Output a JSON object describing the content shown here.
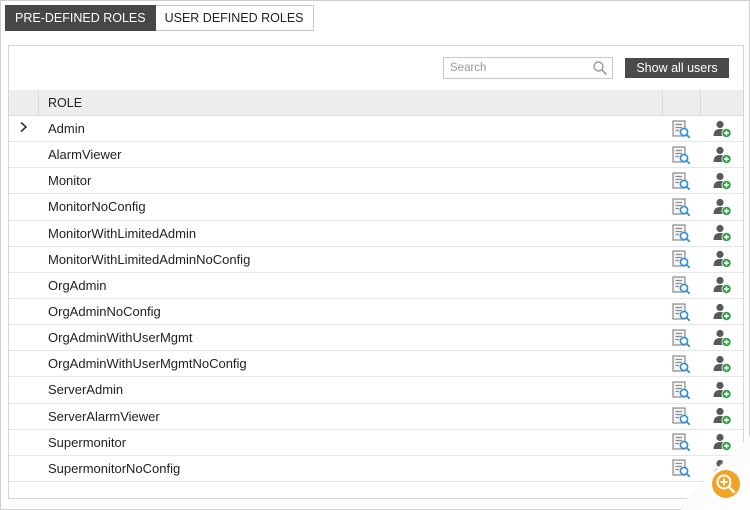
{
  "tabs": [
    {
      "label": "PRE-DEFINED ROLES",
      "active": true
    },
    {
      "label": "USER DEFINED ROLES",
      "active": false
    }
  ],
  "toolbar": {
    "search_placeholder": "Search",
    "search_value": "",
    "show_all_label": "Show all users"
  },
  "grid": {
    "header": {
      "role": "ROLE"
    },
    "rows": [
      {
        "role": "Admin",
        "expandable": true
      },
      {
        "role": "AlarmViewer"
      },
      {
        "role": "Monitor"
      },
      {
        "role": "MonitorNoConfig"
      },
      {
        "role": "MonitorWithLimitedAdmin"
      },
      {
        "role": "MonitorWithLimitedAdminNoConfig"
      },
      {
        "role": "OrgAdmin"
      },
      {
        "role": "OrgAdminNoConfig"
      },
      {
        "role": "OrgAdminWithUserMgmt"
      },
      {
        "role": "OrgAdminWithUserMgmtNoConfig"
      },
      {
        "role": "ServerAdmin"
      },
      {
        "role": "ServerAlarmViewer"
      },
      {
        "role": "Supermonitor"
      },
      {
        "role": "SupermonitorNoConfig"
      }
    ]
  },
  "icons": {
    "row_view": "view-role-icon",
    "row_add": "add-user-icon",
    "search": "search-icon",
    "expand": "chevron-right-icon",
    "zoom": "zoom-in-icon"
  },
  "colors": {
    "active_tab": "#474747",
    "button": "#4a4a4a",
    "add_user_green": "#2e9e45",
    "view_blue": "#2a8fd6",
    "zoom_orange": "#f0a325"
  }
}
